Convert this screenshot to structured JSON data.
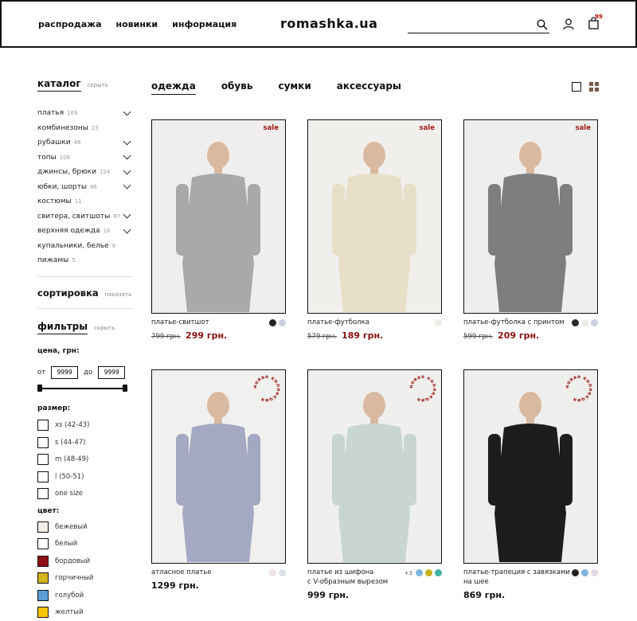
{
  "header": {
    "nav": [
      "распродажа",
      "новинки",
      "информация"
    ],
    "logo": "romashka.ua",
    "search_placeholder": "",
    "cart_count": "99"
  },
  "sidebar": {
    "catalog": {
      "title": "каталог",
      "toggle": "скрыть"
    },
    "categories": [
      {
        "label": "платья",
        "count": "169",
        "expandable": true
      },
      {
        "label": "комбинезоны",
        "count": "23",
        "expandable": false
      },
      {
        "label": "рубашки",
        "count": "46",
        "expandable": true
      },
      {
        "label": "топы",
        "count": "108",
        "expandable": true
      },
      {
        "label": "джинсы, брюки",
        "count": "124",
        "expandable": true
      },
      {
        "label": "юбки, шорты",
        "count": "86",
        "expandable": true
      },
      {
        "label": "костюмы",
        "count": "11",
        "expandable": false
      },
      {
        "label": "свитера, свитшоты",
        "count": "87",
        "expandable": true
      },
      {
        "label": "верхняя одежда",
        "count": "16",
        "expandable": true
      },
      {
        "label": "купальники, белье",
        "count": "9",
        "expandable": false
      },
      {
        "label": "пижамы",
        "count": "5",
        "expandable": false
      }
    ],
    "sorting": {
      "title": "сортировка",
      "toggle": "показать"
    },
    "filters": {
      "title": "фильтры",
      "toggle": "скрыть",
      "price_label": "цена, грн:",
      "from_label": "от",
      "to_label": "до",
      "from_value": "9999",
      "to_value": "9999",
      "size_label": "размер:",
      "sizes": [
        "xs (42-43)",
        "s (44-47)",
        "m (48-49)",
        "l (50-51)",
        "one size"
      ],
      "color_label": "цвет:",
      "colors": [
        {
          "label": "бежевый",
          "hex": "#f2ede6"
        },
        {
          "label": "белый",
          "hex": "#ffffff"
        },
        {
          "label": "бордовый",
          "hex": "#8b0f12"
        },
        {
          "label": "горчичный",
          "hex": "#d4b21c"
        },
        {
          "label": "голубой",
          "hex": "#5b9fd6"
        },
        {
          "label": "желтый",
          "hex": "#f5c400"
        }
      ]
    }
  },
  "tabs": [
    "одежда",
    "обувь",
    "сумки",
    "аксессуары"
  ],
  "new_badge_text": "новая коллекция",
  "products": [
    {
      "name": "платье-свитшот",
      "old_price": "799 грн.",
      "price": "299 грн.",
      "sale": "sale",
      "swatches": [
        "#222222",
        "#c9cfe0"
      ],
      "more": "",
      "bg": "#efeeec",
      "figure": "#a9a9a9"
    },
    {
      "name": "платье-футболка",
      "old_price": "579 грн.",
      "price": "189 грн.",
      "sale": "sale",
      "swatches": [
        "#efebe6"
      ],
      "more": "",
      "bg": "#f0efec",
      "figure": "#e8dfc8"
    },
    {
      "name": "платье-футболка с принтом",
      "old_price": "599 грн.",
      "price": "209 грн.",
      "sale": "sale",
      "swatches": [
        "#2a2a2a",
        "#efebe6",
        "#c9cfe0"
      ],
      "more": "",
      "bg": "#eeeeec",
      "figure": "#7e7e80"
    },
    {
      "name": "атласное платье",
      "old_price": "",
      "price": "1299 грн.",
      "sale": "",
      "swatches": [
        "#efe4e4",
        "#dde1ea"
      ],
      "more": "",
      "bg": "#f0f0ee",
      "figure": "#a4a8c2"
    },
    {
      "name": "платье из шифона\nс V-образным вырезом",
      "old_price": "",
      "price": "999 грн.",
      "sale": "",
      "swatches": [
        "#7fb4dc",
        "#c9b21c",
        "#45b3a3"
      ],
      "more": "+3",
      "bg": "#efefed",
      "figure": "#c8d6cf"
    },
    {
      "name": "платье-трапеция с завязками\nна шее",
      "old_price": "",
      "price": "869 грн.",
      "sale": "",
      "swatches": [
        "#222222",
        "#7fb4dc",
        "#e1d8e8"
      ],
      "more": "",
      "bg": "#eeeeec",
      "figure": "#1d1d1d"
    }
  ]
}
